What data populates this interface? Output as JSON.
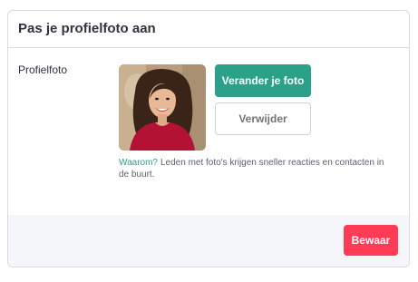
{
  "card": {
    "title": "Pas je profielfoto aan"
  },
  "profile_photo": {
    "label": "Profielfoto",
    "change_button": "Verander je foto",
    "remove_button": "Verwijder",
    "help_link": "Waarom?",
    "help_text": "Leden met foto's krijgen sneller reacties en contacten in de buurt."
  },
  "footer": {
    "save_button": "Bewaar"
  },
  "colors": {
    "primary": "#2ba189",
    "danger": "#ff3b55",
    "text": "#2f3442"
  }
}
